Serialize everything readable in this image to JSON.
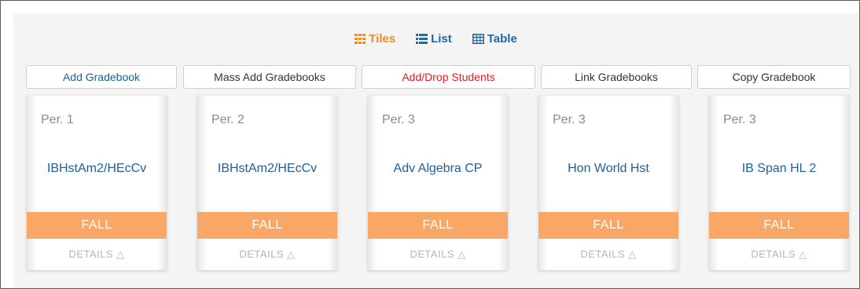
{
  "views": {
    "tiles": {
      "label": "Tiles",
      "icon": "grid-icon"
    },
    "list": {
      "label": "List",
      "icon": "list-icon"
    },
    "table": {
      "label": "Table",
      "icon": "table-icon"
    }
  },
  "actions": {
    "add_gradebook": "Add Gradebook",
    "mass_add": "Mass Add Gradebooks",
    "add_drop": "Add/Drop Students",
    "link": "Link Gradebooks",
    "copy": "Copy Gradebook"
  },
  "tiles": [
    {
      "period": "Per. 1",
      "course": "IBHstAm2/HEcCv",
      "term": "FALL",
      "details": "DETAILS △"
    },
    {
      "period": "Per. 2",
      "course": "IBHstAm2/HEcCv",
      "term": "FALL",
      "details": "DETAILS △"
    },
    {
      "period": "Per. 3",
      "course": "Adv Algebra CP",
      "term": "FALL",
      "details": "DETAILS △"
    },
    {
      "period": "Per. 3",
      "course": "Hon World Hst",
      "term": "FALL",
      "details": "DETAILS △"
    },
    {
      "period": "Per. 3",
      "course": "IB Span HL 2",
      "term": "FALL",
      "details": "DETAILS △"
    }
  ],
  "colors": {
    "active_view": "#f08d1d",
    "link_blue": "#1f5f9a",
    "term_band": "#f9a767",
    "alert_red": "#e02020"
  }
}
